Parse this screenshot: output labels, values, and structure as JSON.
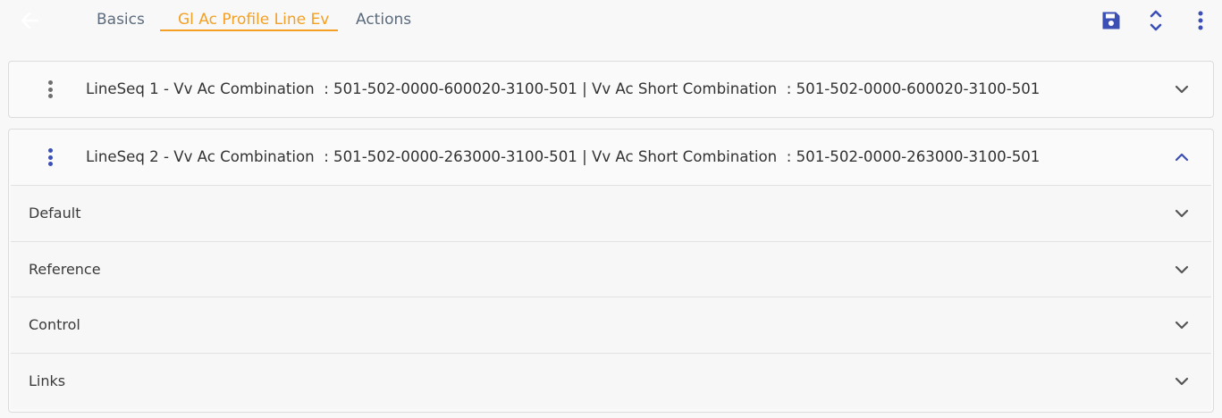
{
  "header": {
    "back_icon": "arrow-left-icon",
    "tabs": [
      {
        "label": "Basics",
        "active": false
      },
      {
        "label": "Gl Ac Profile Line Ev",
        "active": true
      },
      {
        "label": "Actions",
        "active": false
      }
    ],
    "actions": [
      {
        "name": "save-icon",
        "color": "#3b4fb5"
      },
      {
        "name": "expand-collapse-icon",
        "color": "#3b4fb5"
      },
      {
        "name": "more-vertical-icon",
        "color": "#3b4fb5"
      }
    ]
  },
  "colors": {
    "accent": "#f4a024",
    "primary": "#3b4fb5",
    "tab_inactive": "#5b6b7c"
  },
  "lines": [
    {
      "title": "LineSeq 1 - Vv Ac Combination  : 501-502-0000-600020-3100-501 | Vv Ac Short Combination  : 501-502-0000-600020-3100-501",
      "expanded": false
    },
    {
      "title": "LineSeq 2 - Vv Ac Combination  : 501-502-0000-263000-3100-501 | Vv Ac Short Combination  : 501-502-0000-263000-3100-501",
      "expanded": true,
      "sections": [
        {
          "label": "Default"
        },
        {
          "label": "Reference"
        },
        {
          "label": "Control"
        },
        {
          "label": "Links"
        }
      ]
    }
  ]
}
